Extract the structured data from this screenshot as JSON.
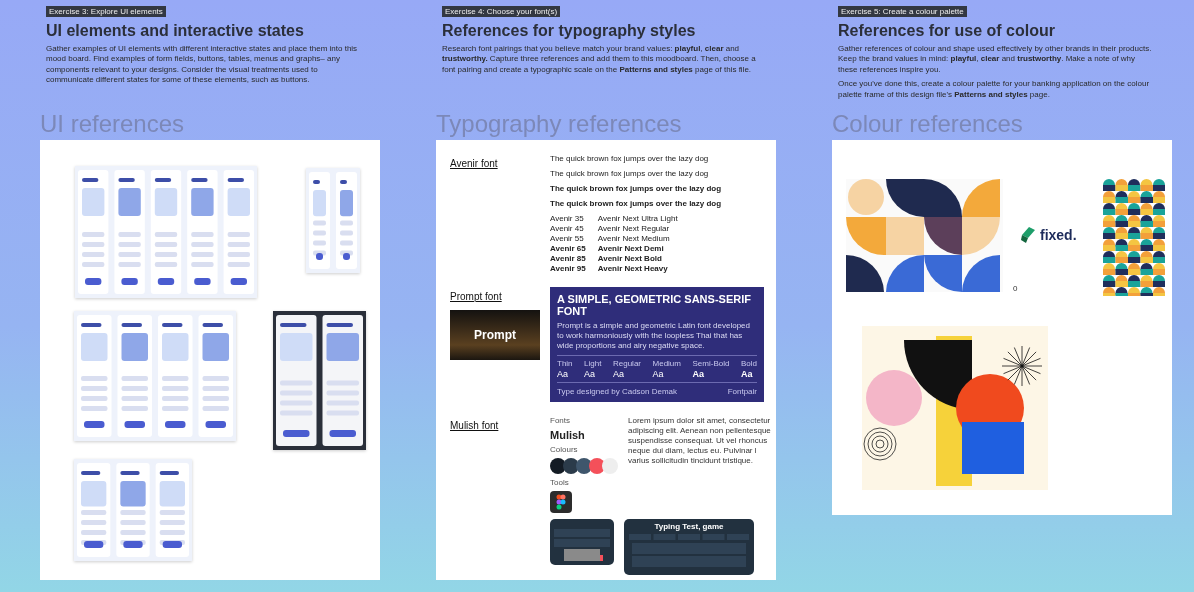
{
  "ui_board": {
    "exercise": "Exercise 3: Explore UI elements",
    "title": "UI elements and interactive states",
    "paragraphs": [
      "Gather examples of UI elements with different interactive states and place them into this mood board. Find examples of form fields, buttons, tables, menus and graphs– any components relevant to your designs. Consider the visual treatments used to communicate different states for some of these elements, such as buttons."
    ],
    "heading": "UI references"
  },
  "typography_board": {
    "exercise": "Exercise 4: Choose your font(s)",
    "title": "References for typography styles",
    "paragraphs": [
      "Research font pairings that you believe match your brand values: **playful**, **clear** and **trustworthy.** Capture three references and add them to this moodboard. Then, choose a font pairing and create a typographic scale on the **Patterns and styles** page of this file."
    ],
    "heading": "Typography references",
    "avenir": {
      "label": "Avenir font",
      "samples": [
        "The quick brown fox jumps over the lazy dog",
        "The quick brown fox jumps over the lazy dog",
        "The quick brown fox jumps over the lazy dog",
        "The quick brown fox jumps over the lazy dog"
      ],
      "weights": [
        {
          "left": "Avenir 35",
          "right": "Avenir Next Ultra Light"
        },
        {
          "left": "Avenir 45",
          "right": "Avenir Next Regular"
        },
        {
          "left": "Avenir 55",
          "right": "Avenir Next Medium"
        },
        {
          "left": "Avenir 65",
          "right": "Avenir Next Demi"
        },
        {
          "left": "Avenir 85",
          "right": "Avenir Next Bold"
        },
        {
          "left": "Avenir 95",
          "right": "Avenir Next Heavy"
        }
      ]
    },
    "prompt": {
      "label": "Prompt font",
      "banner": "Prompt",
      "poster_title": "A SIMPLE, GEOMETRIC SANS-SERIF FONT",
      "poster_text": "Prompt is a simple and geometric Latin font developed to work harmoniously with the loopless Thai that has wide proportions and airy negative space.",
      "weights": [
        {
          "label": "Thin",
          "sample": "Aa"
        },
        {
          "label": "Light",
          "sample": "Aa"
        },
        {
          "label": "Regular",
          "sample": "Aa"
        },
        {
          "label": "Medium",
          "sample": "Aa"
        },
        {
          "label": "Semi-Bold",
          "sample": "Aa"
        },
        {
          "label": "Bold",
          "sample": "Aa"
        }
      ],
      "credit": "Type designed by Cadson Demak",
      "brand": "Fontpair"
    },
    "mulish": {
      "label": "Mulish font",
      "fonts_label": "Fonts",
      "font_name": "Mulish",
      "lorem": "Lorem ipsum dolor sit amet, consectetur adipiscing elit. Aenean non pellentesque suspendisse consequat. Ut vel rhoncus neque dui diam, lectus eu. Pulvinar l varius sollicitudin tincidunt tristique.",
      "colours_label": "Colours",
      "swatches": [
        {
          "color": "#131b24"
        },
        {
          "color": "#2b3b4a"
        },
        {
          "color": "#3f566c"
        },
        {
          "color": "#f4505a"
        },
        {
          "color": "#eeeeee"
        }
      ],
      "tools_label": "Tools",
      "game_title": "Typing Test, game"
    }
  },
  "colour_board": {
    "exercise": "Exercise 5: Create a colour palette",
    "title": "References for use of colour",
    "paragraphs": [
      "Gather references of colour and shape used effectively by other brands in their products. Keep the brand values in mind: **playful**, **clear** and **trustworthy**. Make a note of why these references inspire you.",
      "Once you've done this, create a colour palette for your banking application on the colour palette frame of this design file's **Patterns and styles** page."
    ],
    "heading": "Colour references",
    "logo": "fixed.",
    "caption": "0"
  }
}
